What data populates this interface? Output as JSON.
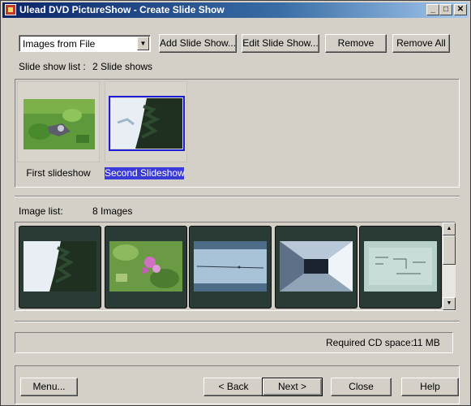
{
  "window": {
    "title": "Ulead DVD PictureShow - Create Slide Show",
    "minimize_glyph": "_",
    "maximize_glyph": "□",
    "close_glyph": "✕"
  },
  "toolbar": {
    "source_dropdown_value": "Images from File",
    "add_slideshow_label": "Add Slide Show...",
    "edit_slideshow_label": "Edit Slide Show...",
    "remove_label": "Remove",
    "remove_all_label": "Remove All"
  },
  "slideshow_list": {
    "label": "Slide show list :",
    "count": "2 Slide shows",
    "items": [
      {
        "label": "First slideshow",
        "selected": false
      },
      {
        "label": "Second Slideshow",
        "selected": true
      }
    ]
  },
  "image_list": {
    "label": "Image list:",
    "count": "8 Images",
    "visible_images": 5
  },
  "status": {
    "cd_space_label": "Required CD space:",
    "cd_space_value": "11 MB"
  },
  "footer": {
    "menu_label": "Menu...",
    "back_label": "< Back",
    "next_label": "Next >",
    "close_label": "Close",
    "help_label": "Help"
  },
  "colors": {
    "titlebar_start": "#0a246a",
    "titlebar_end": "#a6caf0",
    "selection": "#3a3ad8",
    "window_bg": "#d4d0c8"
  }
}
